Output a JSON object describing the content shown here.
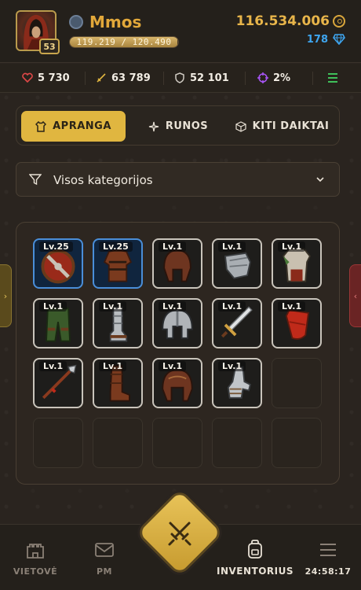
{
  "header": {
    "player_name": "Mmos",
    "level": "53",
    "xp_text": "119.219 / 120.490",
    "xp_fraction": 0.9894,
    "gold": "116.534.006",
    "gems": "178"
  },
  "stats": {
    "health": "5 730",
    "attack": "63 789",
    "defense": "52 101",
    "crit": "2%"
  },
  "tabs": [
    {
      "label": "APRANGA",
      "active": true
    },
    {
      "label": "RUNOS",
      "active": false
    },
    {
      "label": "KITI DAIKTAI",
      "active": false
    }
  ],
  "filter": {
    "label": "Visos kategorijos"
  },
  "inventory": {
    "items": [
      {
        "level": "Lv.25",
        "icon": "round-shield-icon",
        "rarity": "blue"
      },
      {
        "level": "Lv.25",
        "icon": "leather-armor-icon",
        "rarity": "blue"
      },
      {
        "level": "Lv.1",
        "icon": "leather-helmet-icon",
        "rarity": "common"
      },
      {
        "level": "Lv.1",
        "icon": "shoulder-pad-icon",
        "rarity": "common"
      },
      {
        "level": "Lv.1",
        "icon": "tunic-icon",
        "rarity": "common"
      },
      {
        "level": "Lv.1",
        "icon": "green-pants-icon",
        "rarity": "common"
      },
      {
        "level": "Lv.1",
        "icon": "metal-greaves-icon",
        "rarity": "common"
      },
      {
        "level": "Lv.1",
        "icon": "iron-helmet-icon",
        "rarity": "common"
      },
      {
        "level": "Lv.1",
        "icon": "short-sword-icon",
        "rarity": "common"
      },
      {
        "level": "Lv.1",
        "icon": "red-shield-icon",
        "rarity": "common"
      },
      {
        "level": "Lv.1",
        "icon": "spear-icon",
        "rarity": "common"
      },
      {
        "level": "Lv.1",
        "icon": "leather-boots-icon",
        "rarity": "common"
      },
      {
        "level": "Lv.1",
        "icon": "leather-cap-icon",
        "rarity": "common"
      },
      {
        "level": "Lv.1",
        "icon": "gauntlet-icon",
        "rarity": "common"
      }
    ]
  },
  "nav": {
    "locations": "VIETOVĖ",
    "messages": "PM",
    "inventory": "INVENTORIUS",
    "timer": "24:58:17"
  },
  "colors": {
    "accent_gold": "#e0b640",
    "gem_blue": "#3ea5ef",
    "health_red": "#e04848",
    "menu_green": "#3fbf5a"
  }
}
